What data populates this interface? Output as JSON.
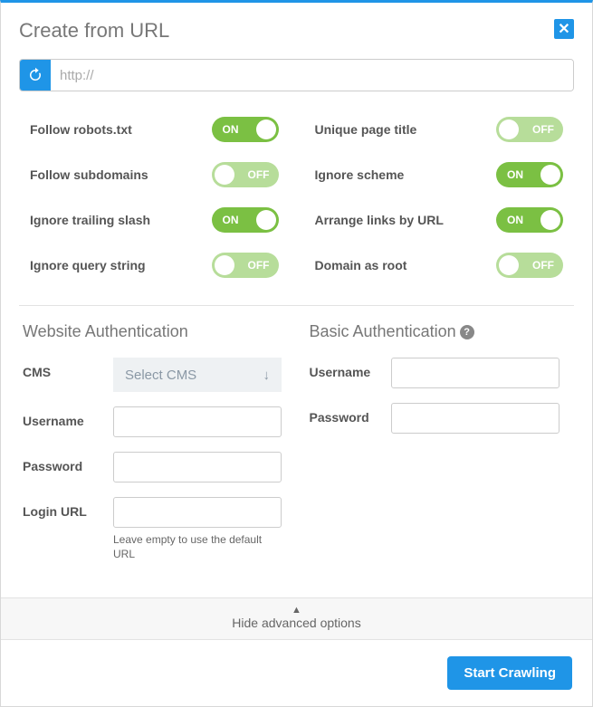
{
  "header": {
    "title": "Create from URL"
  },
  "url_field": {
    "placeholder": "http://",
    "value": ""
  },
  "toggles": {
    "left": [
      {
        "key": "follow-robots",
        "label": "Follow robots.txt",
        "on": true
      },
      {
        "key": "follow-subdomains",
        "label": "Follow subdomains",
        "on": false
      },
      {
        "key": "ignore-slash",
        "label": "Ignore trailing slash",
        "on": true
      },
      {
        "key": "ignore-query",
        "label": "Ignore query string",
        "on": false
      }
    ],
    "right": [
      {
        "key": "unique-title",
        "label": "Unique page title",
        "on": false
      },
      {
        "key": "ignore-scheme",
        "label": "Ignore scheme",
        "on": true
      },
      {
        "key": "arrange-links",
        "label": "Arrange links by URL",
        "on": true
      },
      {
        "key": "domain-root",
        "label": "Domain as root",
        "on": false
      }
    ],
    "on_text": "ON",
    "off_text": "OFF"
  },
  "website_auth": {
    "title": "Website Authentication",
    "cms": {
      "label": "CMS",
      "placeholder": "Select CMS"
    },
    "username": {
      "label": "Username",
      "value": ""
    },
    "password": {
      "label": "Password",
      "value": ""
    },
    "login_url": {
      "label": "Login URL",
      "value": "",
      "hint": "Leave empty to use the default URL"
    }
  },
  "basic_auth": {
    "title": "Basic Authentication",
    "username": {
      "label": "Username",
      "value": ""
    },
    "password": {
      "label": "Password",
      "value": ""
    }
  },
  "advanced": {
    "label": "Hide advanced options"
  },
  "footer": {
    "start_button": "Start Crawling"
  }
}
